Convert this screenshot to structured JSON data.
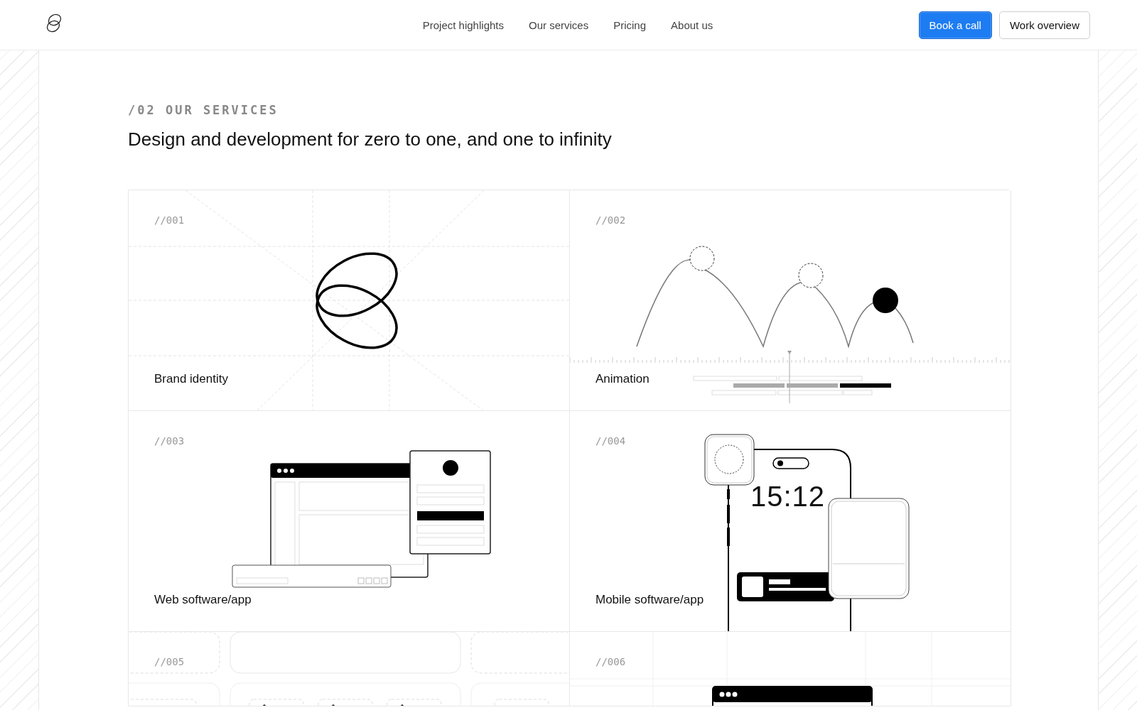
{
  "header": {
    "nav": [
      {
        "label": "Project highlights"
      },
      {
        "label": "Our services"
      },
      {
        "label": "Pricing"
      },
      {
        "label": "About us"
      }
    ],
    "buttons": [
      {
        "label": "Book a call",
        "kind": "primary"
      },
      {
        "label": "Work overview",
        "kind": "secondary"
      }
    ]
  },
  "section": {
    "eyebrow": "/02 OUR SERVICES",
    "title": "Design and development for zero to one, and one to infinity"
  },
  "services": [
    {
      "number": "//001",
      "title": "Brand identity",
      "kind": "brand"
    },
    {
      "number": "//002",
      "title": "Animation",
      "kind": "animation"
    },
    {
      "number": "//003",
      "title": "Web software/app",
      "kind": "web"
    },
    {
      "number": "//004",
      "title": "Mobile software/app",
      "kind": "mobile",
      "clock": "15:12"
    },
    {
      "number": "//005",
      "kind": "components"
    },
    {
      "number": "//006",
      "kind": "window"
    }
  ]
}
